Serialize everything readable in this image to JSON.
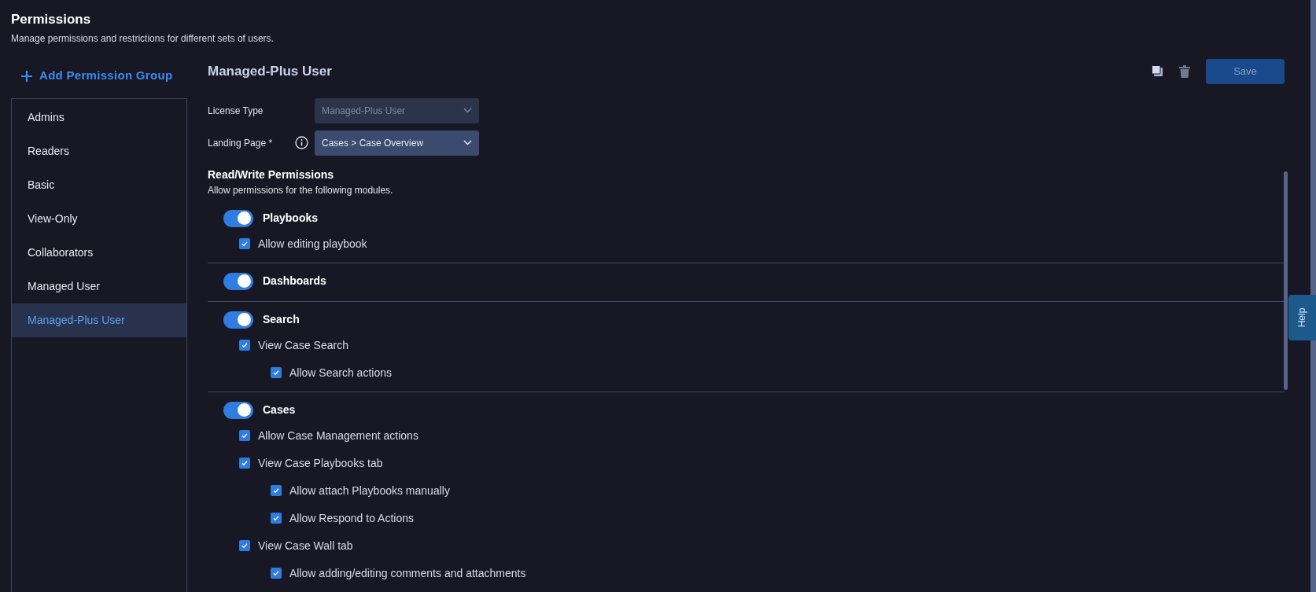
{
  "header": {
    "title": "Permissions",
    "subtitle": "Manage permissions and restrictions for different sets of users."
  },
  "sidebar": {
    "add_button": "Add Permission Group",
    "items": [
      {
        "label": "Admins",
        "selected": false
      },
      {
        "label": "Readers",
        "selected": false
      },
      {
        "label": "Basic",
        "selected": false
      },
      {
        "label": "View-Only",
        "selected": false
      },
      {
        "label": "Collaborators",
        "selected": false
      },
      {
        "label": "Managed User",
        "selected": false
      },
      {
        "label": "Managed-Plus User",
        "selected": true
      }
    ]
  },
  "detail": {
    "title": "Managed-Plus User",
    "save_button": {
      "label": "Save",
      "disabled": true
    },
    "fields": [
      {
        "label": "License Type",
        "value": "Managed-Plus User",
        "disabled": true,
        "info": false
      },
      {
        "label": "Landing Page *",
        "value": "Cases > Case Overview",
        "disabled": false,
        "info": true
      }
    ],
    "permissions": {
      "title": "Read/Write Permissions",
      "subtitle": "Allow permissions for the following modules.",
      "modules": [
        {
          "label": "Playbooks",
          "on": true,
          "children": [
            {
              "label": "Allow editing playbook",
              "checked": true
            }
          ]
        },
        {
          "label": "Dashboards",
          "on": true
        },
        {
          "label": "Search",
          "on": true,
          "children": [
            {
              "label": "View Case Search",
              "checked": true,
              "children": [
                {
                  "label": "Allow Search actions",
                  "checked": true
                }
              ]
            }
          ]
        },
        {
          "label": "Cases",
          "on": true,
          "children": [
            {
              "label": "Allow Case Management actions",
              "checked": true
            },
            {
              "label": "View Case Playbooks tab",
              "checked": true,
              "children": [
                {
                  "label": "Allow attach Playbooks manually",
                  "checked": true
                },
                {
                  "label": "Allow Respond to Actions",
                  "checked": true
                }
              ]
            },
            {
              "label": "View Case Wall tab",
              "checked": true,
              "children": [
                {
                  "label": "Allow adding/editing comments and attachments",
                  "checked": true
                }
              ]
            }
          ]
        }
      ]
    }
  },
  "help_tab": "Help"
}
